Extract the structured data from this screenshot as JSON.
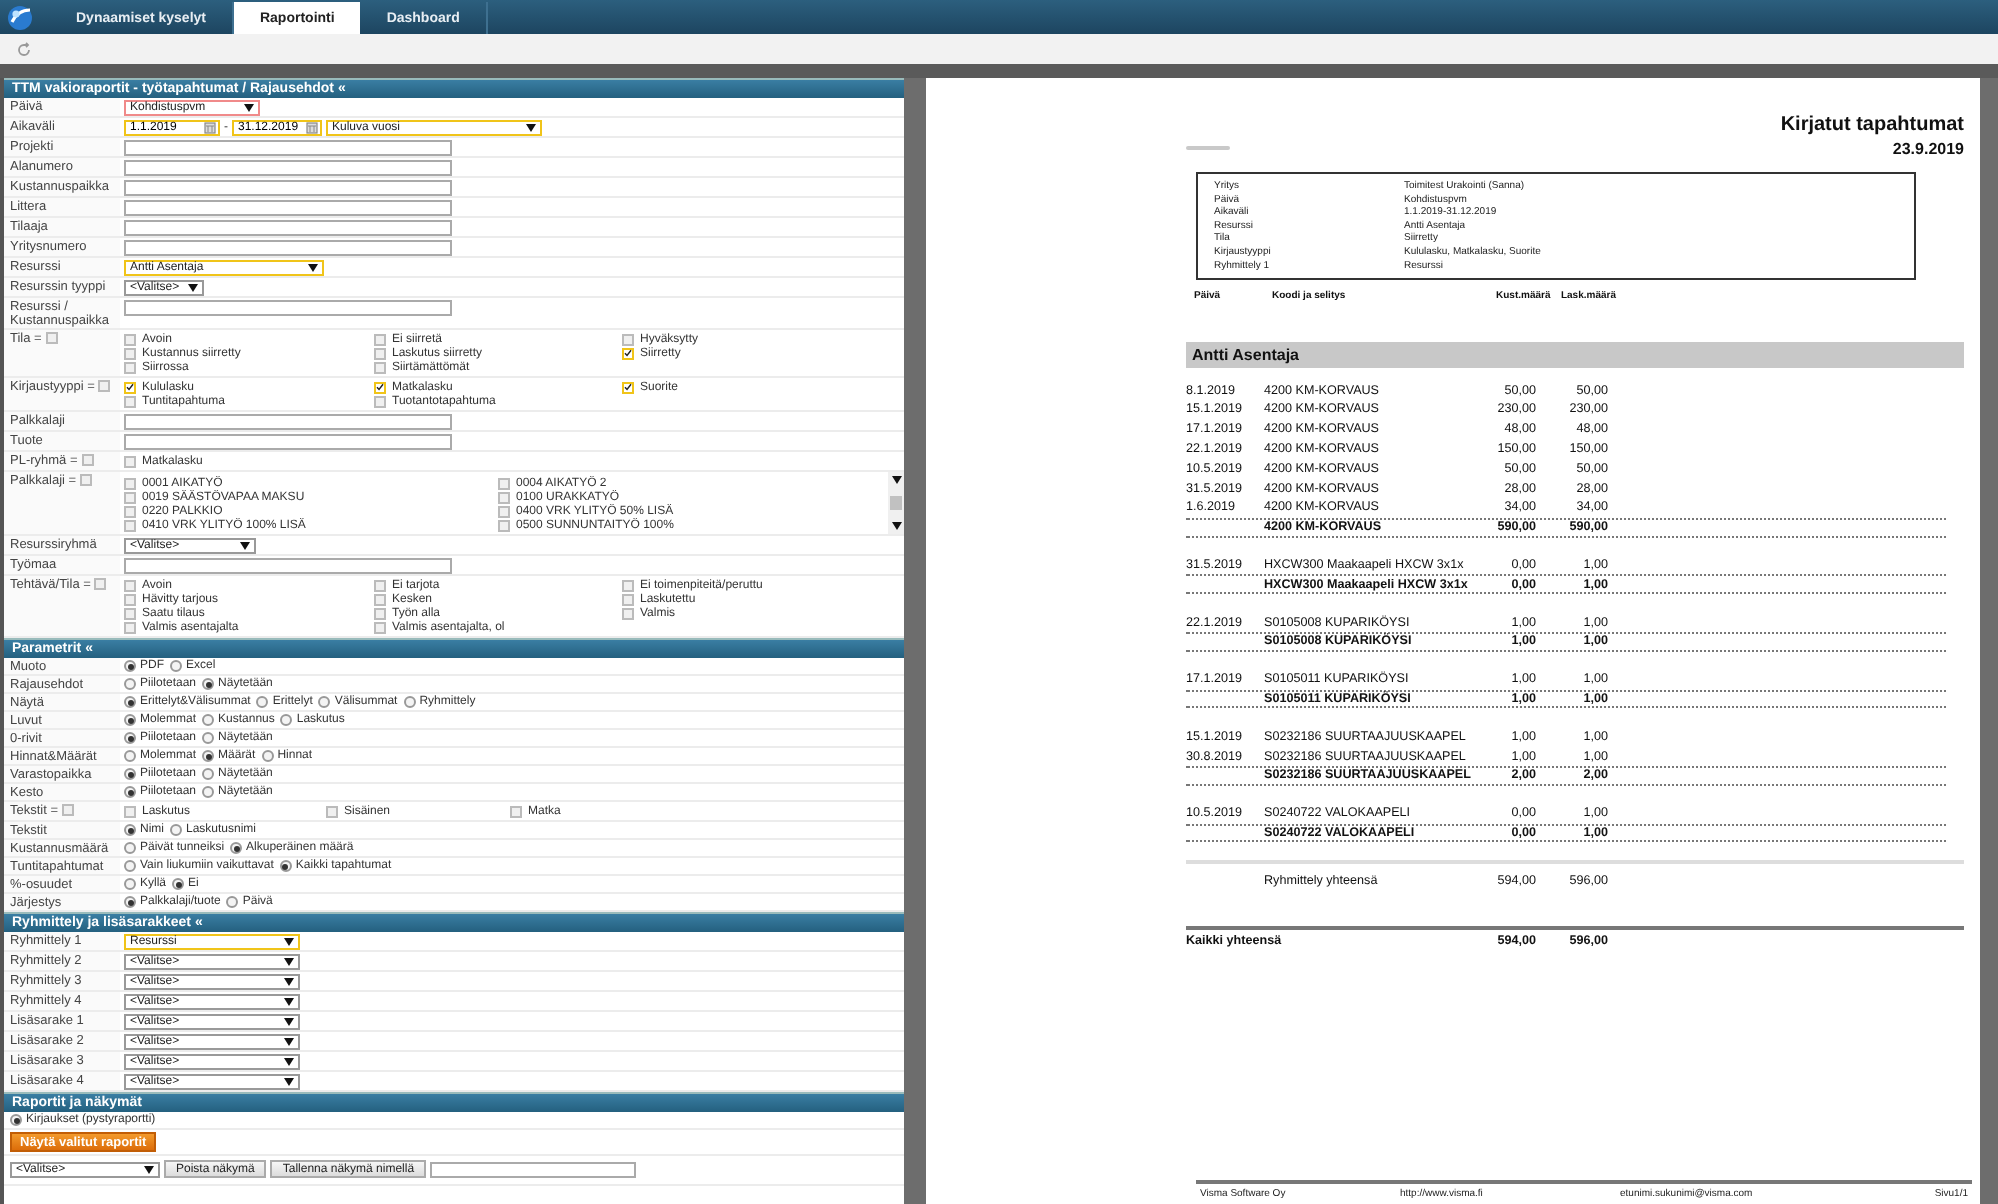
{
  "nav": {
    "tabs": [
      {
        "label": "Dynaamiset kyselyt",
        "selected": false
      },
      {
        "label": "Raportointi",
        "selected": true
      },
      {
        "label": "Dashboard",
        "selected": false
      }
    ]
  },
  "sections": [
    {
      "title": "TTM vakioraportit - työtapahtumat / Rajausehdot «",
      "kind": "form",
      "rows": [
        {
          "label": "Päivä",
          "kind": "select",
          "value": "Kohdistuspvm",
          "required": true
        },
        {
          "label": "Aikaväli",
          "kind": "daterange",
          "from": "1.1.2019",
          "to": "31.12.2019",
          "separator": "-",
          "preset": "Kuluva vuosi",
          "changed": true
        },
        {
          "label": "Projekti",
          "kind": "text"
        },
        {
          "label": "Alanumero",
          "kind": "text"
        },
        {
          "label": "Kustannuspaikka",
          "kind": "text"
        },
        {
          "label": "Littera",
          "kind": "text"
        },
        {
          "label": "Tilaaja",
          "kind": "text"
        },
        {
          "label": "Yritysnumero",
          "kind": "text"
        },
        {
          "label": "Resurssi",
          "kind": "select",
          "value": "Antti Asentaja",
          "changed": true
        },
        {
          "label": "Resurssin tyyppi",
          "kind": "select",
          "value": "<Valitse>"
        },
        {
          "label": "Resurssi / Kustannuspaikka",
          "kind": "text"
        },
        {
          "label": "Tila =",
          "kind": "checks",
          "select_all": false,
          "options": [
            {
              "label": "Avoin",
              "checked": false
            },
            {
              "label": "Ei siirretä",
              "checked": false
            },
            {
              "label": "Hyväksytty",
              "checked": false
            },
            {
              "label": "Kustannus siirretty",
              "checked": false
            },
            {
              "label": "Laskutus siirretty",
              "checked": false
            },
            {
              "label": "Siirretty",
              "checked": true
            },
            {
              "label": "Siirrossa",
              "checked": false
            },
            {
              "label": "Siirtämättömät",
              "checked": false
            }
          ]
        },
        {
          "label": "Kirjaustyyppi =",
          "kind": "checks",
          "select_all": false,
          "options": [
            {
              "label": "Kululasku",
              "checked": true
            },
            {
              "label": "Matkalasku",
              "checked": true
            },
            {
              "label": "Suorite",
              "checked": true
            },
            {
              "label": "Tuntitapahtuma",
              "checked": false
            },
            {
              "label": "Tuotantotapahtuma",
              "checked": false
            }
          ]
        },
        {
          "label": "Palkkalaji",
          "kind": "text"
        },
        {
          "label": "Tuote",
          "kind": "text"
        },
        {
          "label": "PL-ryhmä =",
          "kind": "checks",
          "select_all": false,
          "options": [
            {
              "label": "Matkalasku",
              "checked": false
            }
          ]
        },
        {
          "label": "Palkkalaji =",
          "kind": "list",
          "select_all": false,
          "options": [
            {
              "label": "0001 AIKATYÖ",
              "checked": false
            },
            {
              "label": "0004 AIKATYÖ 2",
              "checked": false
            },
            {
              "label": "0019 SÄÄSTÖVAPAA MAKSU",
              "checked": false
            },
            {
              "label": "0100 URAKKATYÖ",
              "checked": false
            },
            {
              "label": "0220 PALKKIO",
              "checked": false
            },
            {
              "label": "0400 VRK YLITYÖ 50% LISÄ",
              "checked": false
            },
            {
              "label": "0410 VRK YLITYÖ 100% LISÄ",
              "checked": false
            },
            {
              "label": "0500 SUNNUNTAITYÖ 100%",
              "checked": false
            }
          ]
        },
        {
          "label": "Resurssiryhmä",
          "kind": "select",
          "value": "<Valitse>"
        },
        {
          "label": "Työmaa",
          "kind": "text"
        },
        {
          "label": "Tehtävä/Tila =",
          "kind": "checks",
          "select_all": false,
          "options": [
            {
              "label": "Avoin",
              "checked": false
            },
            {
              "label": "Ei tarjota",
              "checked": false
            },
            {
              "label": "Ei toimenpiteitä/peruttu",
              "checked": false
            },
            {
              "label": "Hävitty tarjous",
              "checked": false
            },
            {
              "label": "Kesken",
              "checked": false
            },
            {
              "label": "Laskutettu",
              "checked": false
            },
            {
              "label": "Saatu tilaus",
              "checked": false
            },
            {
              "label": "Työn alla",
              "checked": false
            },
            {
              "label": "Valmis",
              "checked": false
            },
            {
              "label": "Valmis asentajalta",
              "checked": false
            },
            {
              "label": "Valmis asentajalta, ol",
              "checked": false
            }
          ]
        }
      ]
    },
    {
      "title": "Parametrit «",
      "kind": "form",
      "rows": [
        {
          "label": "Muoto",
          "kind": "radios",
          "options": [
            {
              "label": "PDF",
              "selected": true
            },
            {
              "label": "Excel",
              "selected": false
            }
          ]
        },
        {
          "label": "Rajausehdot",
          "kind": "radios",
          "options": [
            {
              "label": "Piilotetaan",
              "selected": false
            },
            {
              "label": "Näytetään",
              "selected": true
            }
          ]
        },
        {
          "label": "Näytä",
          "kind": "radios",
          "options": [
            {
              "label": "Erittelyt&Välisummat",
              "selected": true
            },
            {
              "label": "Erittelyt",
              "selected": false
            },
            {
              "label": "Välisummat",
              "selected": false
            },
            {
              "label": "Ryhmittely",
              "selected": false
            }
          ]
        },
        {
          "label": "Luvut",
          "kind": "radios",
          "options": [
            {
              "label": "Molemmat",
              "selected": true
            },
            {
              "label": "Kustannus",
              "selected": false
            },
            {
              "label": "Laskutus",
              "selected": false
            }
          ]
        },
        {
          "label": "0-rivit",
          "kind": "radios",
          "options": [
            {
              "label": "Piilotetaan",
              "selected": true
            },
            {
              "label": "Näytetään",
              "selected": false
            }
          ]
        },
        {
          "label": "Hinnat&Määrät",
          "kind": "radios",
          "options": [
            {
              "label": "Molemmat",
              "selected": false
            },
            {
              "label": "Määrät",
              "selected": true
            },
            {
              "label": "Hinnat",
              "selected": false
            }
          ]
        },
        {
          "label": "Varastopaikka",
          "kind": "radios",
          "options": [
            {
              "label": "Piilotetaan",
              "selected": true
            },
            {
              "label": "Näytetään",
              "selected": false
            }
          ]
        },
        {
          "label": "Kesto",
          "kind": "radios",
          "options": [
            {
              "label": "Piilotetaan",
              "selected": true
            },
            {
              "label": "Näytetään",
              "selected": false
            }
          ]
        },
        {
          "label": "Tekstit =",
          "kind": "checks",
          "select_all": false,
          "options": [
            {
              "label": "Laskutus",
              "checked": false
            },
            {
              "label": "Sisäinen",
              "checked": false
            },
            {
              "label": "Matka",
              "checked": false
            }
          ]
        },
        {
          "label": "Tekstit",
          "kind": "radios",
          "options": [
            {
              "label": "Nimi",
              "selected": true
            },
            {
              "label": "Laskutusnimi",
              "selected": false
            }
          ]
        },
        {
          "label": "Kustannusmäärä",
          "kind": "radios",
          "options": [
            {
              "label": "Päivät tunneiksi",
              "selected": false
            },
            {
              "label": "Alkuperäinen määrä",
              "selected": true
            }
          ]
        },
        {
          "label": "Tuntitapahtumat",
          "kind": "radios",
          "options": [
            {
              "label": "Vain liukumiin vaikuttavat",
              "selected": false
            },
            {
              "label": "Kaikki tapahtumat",
              "selected": true
            }
          ]
        },
        {
          "label": "%-osuudet",
          "kind": "radios",
          "options": [
            {
              "label": "Kyllä",
              "selected": false
            },
            {
              "label": "Ei",
              "selected": true
            }
          ]
        },
        {
          "label": "Järjestys",
          "kind": "radios",
          "options": [
            {
              "label": "Palkkalaji/tuote",
              "selected": true
            },
            {
              "label": "Päivä",
              "selected": false
            }
          ]
        }
      ]
    },
    {
      "title": "Ryhmittely ja lisäsarakkeet «",
      "kind": "form",
      "rows": [
        {
          "label": "Ryhmittely 1",
          "kind": "select",
          "value": "Resurssi",
          "changed": true
        },
        {
          "label": "Ryhmittely 2",
          "kind": "select",
          "value": "<Valitse>"
        },
        {
          "label": "Ryhmittely 3",
          "kind": "select",
          "value": "<Valitse>"
        },
        {
          "label": "Ryhmittely 4",
          "kind": "select",
          "value": "<Valitse>"
        },
        {
          "label": "Lisäsarake 1",
          "kind": "select",
          "value": "<Valitse>"
        },
        {
          "label": "Lisäsarake 2",
          "kind": "select",
          "value": "<Valitse>"
        },
        {
          "label": "Lisäsarake 3",
          "kind": "select",
          "value": "<Valitse>"
        },
        {
          "label": "Lisäsarake 4",
          "kind": "select",
          "value": "<Valitse>"
        }
      ]
    },
    {
      "title": "Raportit ja näkymät",
      "kind": "actions",
      "report_option": {
        "label": "Kirjaukset (pystyraportti)",
        "selected": true
      },
      "run_button": "Näytä valitut raportit",
      "view_select": "<Valitse>",
      "buttons": [
        "Poista näkymä",
        "Tallenna näkymä nimellä"
      ]
    }
  ],
  "report": {
    "title": "Kirjatut tapahtumat",
    "date": "23.9.2019",
    "info": [
      {
        "key": "Yritys",
        "value": "Toimitest Urakointi (Sanna)"
      },
      {
        "key": "Päivä",
        "value": "Kohdistuspvm"
      },
      {
        "key": "Aikaväli",
        "value": "1.1.2019-31.12.2019"
      },
      {
        "key": "Resurssi",
        "value": "Antti Asentaja"
      },
      {
        "key": "Tila",
        "value": "Siirretty"
      },
      {
        "key": "Kirjaustyyppi",
        "value": "Kululasku, Matkalasku, Suorite"
      },
      {
        "key": "Ryhmittely 1",
        "value": "Resurssi"
      }
    ],
    "columns": [
      "Päivä",
      "Koodi ja selitys",
      "Kust.määrä",
      "Lask.määrä"
    ],
    "group": {
      "name": "Antti Asentaja",
      "blocks": [
        {
          "entries": [
            {
              "date": "8.1.2019",
              "code": "4200 KM-KORVAUS",
              "cost": "50,00",
              "bill": "50,00"
            },
            {
              "date": "15.1.2019",
              "code": "4200 KM-KORVAUS",
              "cost": "230,00",
              "bill": "230,00"
            },
            {
              "date": "17.1.2019",
              "code": "4200 KM-KORVAUS",
              "cost": "48,00",
              "bill": "48,00"
            },
            {
              "date": "22.1.2019",
              "code": "4200 KM-KORVAUS",
              "cost": "150,00",
              "bill": "150,00"
            },
            {
              "date": "10.5.2019",
              "code": "4200 KM-KORVAUS",
              "cost": "50,00",
              "bill": "50,00"
            },
            {
              "date": "31.5.2019",
              "code": "4200 KM-KORVAUS",
              "cost": "28,00",
              "bill": "28,00"
            },
            {
              "date": "1.6.2019",
              "code": "4200 KM-KORVAUS",
              "cost": "34,00",
              "bill": "34,00"
            }
          ],
          "total": {
            "code": "4200 KM-KORVAUS",
            "cost": "590,00",
            "bill": "590,00"
          }
        },
        {
          "entries": [
            {
              "date": "31.5.2019",
              "code": "HXCW300 Maakaapeli HXCW 3x1x",
              "cost": "0,00",
              "bill": "1,00"
            }
          ],
          "total": {
            "code": "HXCW300 Maakaapeli HXCW 3x1x",
            "cost": "0,00",
            "bill": "1,00"
          }
        },
        {
          "entries": [
            {
              "date": "22.1.2019",
              "code": "S0105008 KUPARIKÖYSI",
              "cost": "1,00",
              "bill": "1,00"
            }
          ],
          "total": {
            "code": "S0105008 KUPARIKÖYSI",
            "cost": "1,00",
            "bill": "1,00"
          }
        },
        {
          "entries": [
            {
              "date": "17.1.2019",
              "code": "S0105011 KUPARIKÖYSI",
              "cost": "1,00",
              "bill": "1,00"
            }
          ],
          "total": {
            "code": "S0105011 KUPARIKÖYSI",
            "cost": "1,00",
            "bill": "1,00"
          }
        },
        {
          "entries": [
            {
              "date": "15.1.2019",
              "code": "S0232186 SUURTAAJUUSKAAPEL",
              "cost": "1,00",
              "bill": "1,00"
            },
            {
              "date": "30.8.2019",
              "code": "S0232186 SUURTAAJUUSKAAPEL",
              "cost": "1,00",
              "bill": "1,00"
            }
          ],
          "total": {
            "code": "S0232186 SUURTAAJUUSKAAPEL",
            "cost": "2,00",
            "bill": "2,00"
          }
        },
        {
          "entries": [
            {
              "date": "10.5.2019",
              "code": "S0240722 VALOKAAPELI",
              "cost": "0,00",
              "bill": "1,00"
            }
          ],
          "total": {
            "code": "S0240722 VALOKAAPELI",
            "cost": "0,00",
            "bill": "1,00"
          }
        }
      ],
      "total": {
        "label": "Ryhmittely yhteensä",
        "cost": "594,00",
        "bill": "596,00"
      }
    },
    "grand_total": {
      "label": "Kaikki yhteensä",
      "cost": "594,00",
      "bill": "596,00"
    },
    "footer": [
      "Visma Software Oy",
      "http://www.visma.fi",
      "etunimi.sukunimi@visma.com",
      "Sivu1/1"
    ]
  }
}
